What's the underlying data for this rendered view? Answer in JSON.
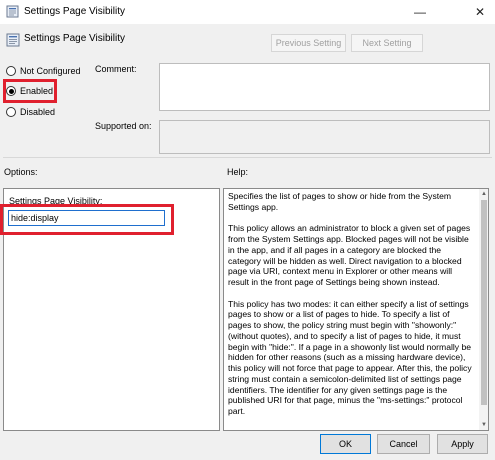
{
  "window": {
    "title": "Settings Page Visibility",
    "minimize_glyph": "—",
    "close_glyph": "✕"
  },
  "header": {
    "title": "Settings Page Visibility",
    "prev_label": "Previous Setting",
    "next_label": "Next Setting"
  },
  "state": {
    "options": [
      "Not Configured",
      "Enabled",
      "Disabled"
    ],
    "selected": "Enabled"
  },
  "fields": {
    "comment_label": "Comment:",
    "supported_label": "Supported on:"
  },
  "sections": {
    "options_label": "Options:",
    "help_label": "Help:"
  },
  "options_panel": {
    "spv_label": "Settings Page Visibility:",
    "spv_value": "hide:display"
  },
  "help": {
    "paragraphs": [
      "Specifies the list of pages to show or hide from the System Settings app.",
      "This policy allows an administrator to block a given set of pages from the System Settings app. Blocked pages will not be visible in the app, and if all pages in a category are blocked the category will be hidden as well. Direct navigation to a blocked page via URI, context menu in Explorer or other means will result in the front page of Settings being shown instead.",
      "This policy has two modes: it can either specify a list of settings pages to show or a list of pages to hide. To specify a list of pages to show, the policy string must begin with \"showonly:\" (without quotes), and to specify a list of pages to hide, it must begin with \"hide:\". If a page in a showonly list would normally be hidden for other reasons (such as a missing hardware device), this policy will not force that page to appear. After this, the policy string must contain a semicolon-delimited list of settings page identifiers. The identifier for any given settings page is the published URI for that page, minus the \"ms-settings:\" protocol part."
    ]
  },
  "footer": {
    "ok_label": "OK",
    "cancel_label": "Cancel",
    "apply_label": "Apply"
  },
  "colors": {
    "highlight": "#e0202e",
    "focus_border": "#1f6fce",
    "dialog_bg": "#f0f0f0"
  }
}
